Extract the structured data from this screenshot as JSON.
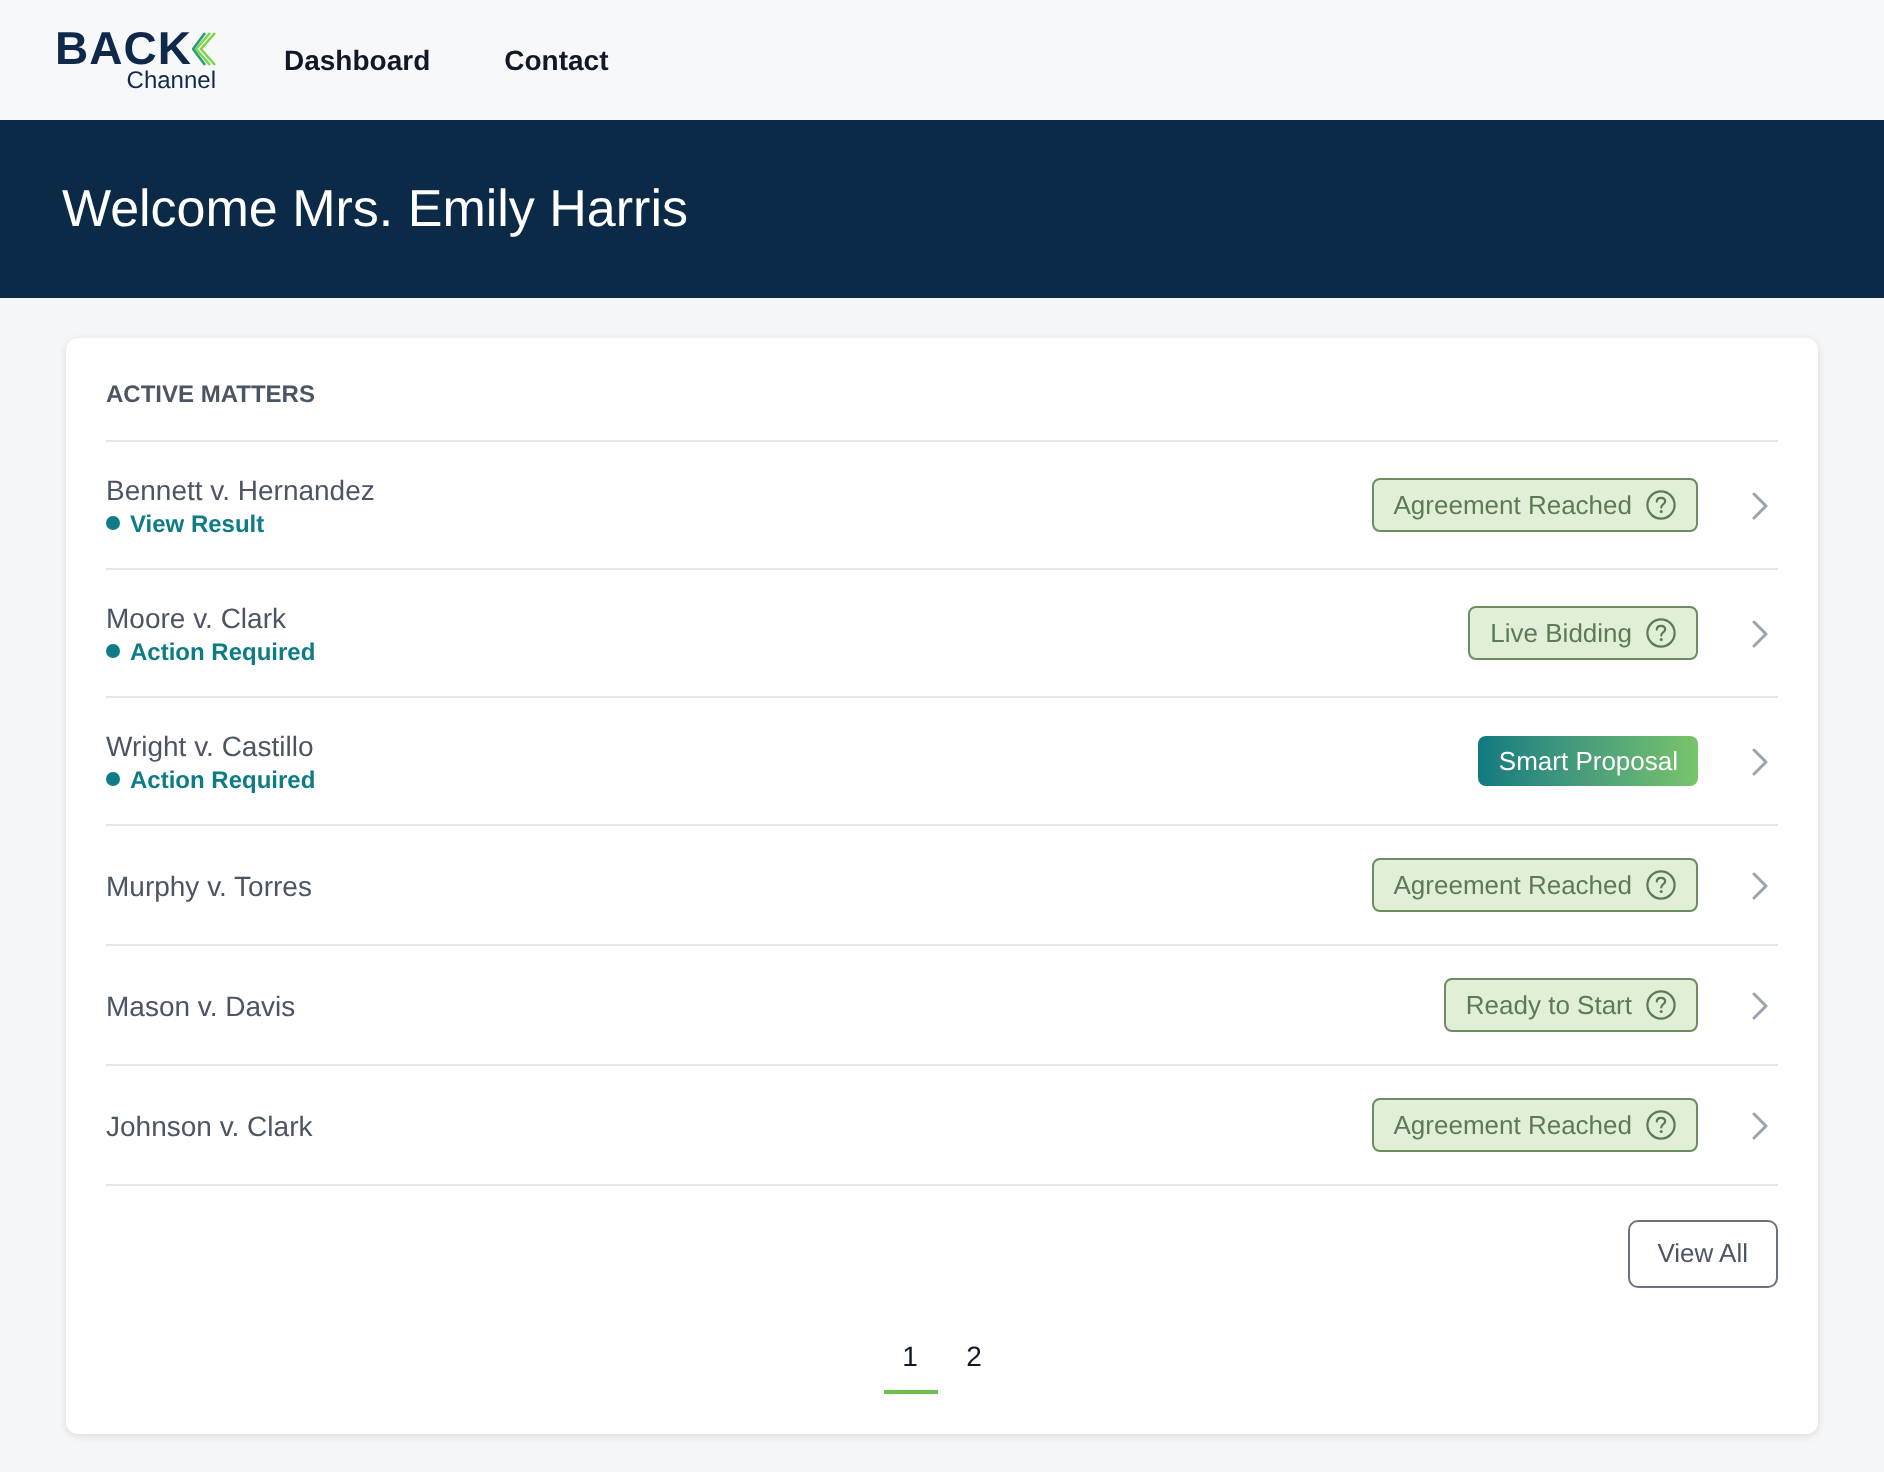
{
  "nav": {
    "logo": {
      "line_1": "BACK",
      "line_2": "Channel"
    },
    "links": [
      {
        "label": "Dashboard"
      },
      {
        "label": "Contact"
      }
    ]
  },
  "banner": {
    "title": "Welcome Mrs. Emily Harris"
  },
  "matters": {
    "heading": "ACTIVE MATTERS",
    "rows": [
      {
        "name": "Bennett v. Hernandez",
        "status": "View Result",
        "badge": {
          "kind": "outline",
          "label": "Agreement Reached"
        }
      },
      {
        "name": "Moore v. Clark",
        "status": "Action Required",
        "badge": {
          "kind": "outline",
          "label": "Live Bidding"
        }
      },
      {
        "name": "Wright v. Castillo",
        "status": "Action Required",
        "badge": {
          "kind": "gradient",
          "label": "Smart Proposal"
        }
      },
      {
        "name": "Murphy v. Torres",
        "badge": {
          "kind": "outline",
          "label": "Agreement Reached"
        }
      },
      {
        "name": "Mason v. Davis",
        "badge": {
          "kind": "outline",
          "label": "Ready to Start"
        }
      },
      {
        "name": "Johnson v. Clark",
        "badge": {
          "kind": "outline",
          "label": "Agreement Reached"
        }
      }
    ],
    "view_all": "View All",
    "pagination": [
      {
        "label": "1",
        "selected": true
      },
      {
        "label": "2",
        "selected": false
      }
    ]
  }
}
